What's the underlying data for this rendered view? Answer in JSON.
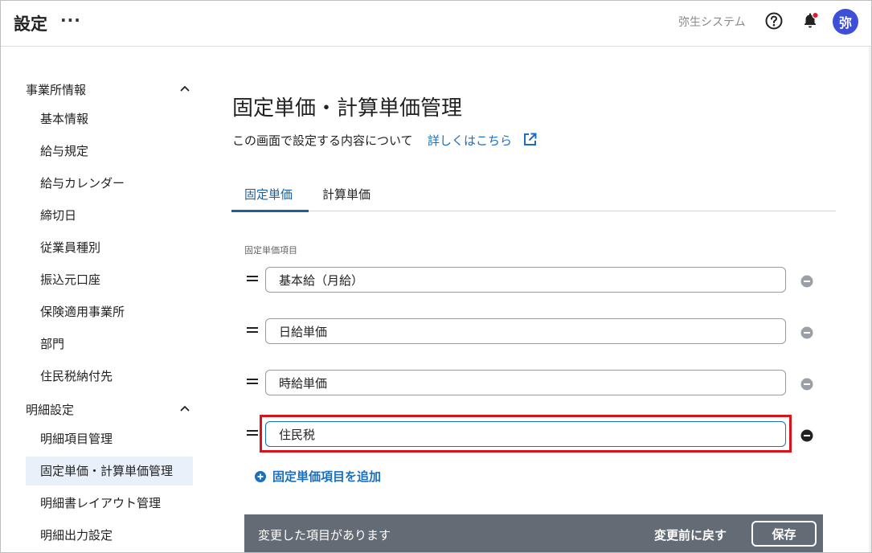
{
  "header": {
    "title": "設定",
    "more_label": "···",
    "company": "弥生システム",
    "avatar_text": "弥",
    "help_icon": "help-circle-icon",
    "bell_icon": "bell-icon",
    "notification_dot_color": "#e0192b",
    "avatar_color": "#3d4ed8"
  },
  "sidebar": {
    "sections": [
      {
        "label": "事業所情報",
        "items": [
          "基本情報",
          "給与規定",
          "給与カレンダー",
          "締切日",
          "従業員種別",
          "振込元口座",
          "保険適用事業所",
          "部門",
          "住民税納付先"
        ]
      },
      {
        "label": "明細設定",
        "items": [
          "明細項目管理",
          "固定単価・計算単価管理",
          "明細書レイアウト管理",
          "明細出力設定"
        ]
      }
    ],
    "active_item": "固定単価・計算単価管理"
  },
  "main": {
    "title": "固定単価・計算単価管理",
    "description": "この画面で設定する内容について",
    "details_link": "詳しくはこちら",
    "tabs": [
      {
        "label": "固定単価",
        "active": true
      },
      {
        "label": "計算単価",
        "active": false
      }
    ],
    "section_label": "固定単価項目",
    "items": [
      {
        "value": "基本給（月給）"
      },
      {
        "value": "日給単価"
      },
      {
        "value": "時給単価"
      },
      {
        "value": "住民税"
      }
    ],
    "add_label": "固定単価項目を追加"
  },
  "footer": {
    "message": "変更した項目があります",
    "revert_label": "変更前に戻す",
    "save_label": "保存"
  },
  "colors": {
    "accent": "#1a6fc0",
    "highlight": "#d8141a",
    "footer_bg": "#636b74",
    "active_bg": "#e8f1fa"
  }
}
